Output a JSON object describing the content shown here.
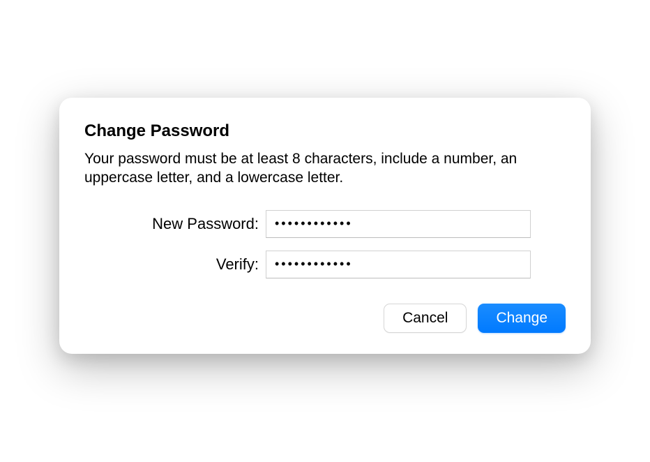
{
  "dialog": {
    "title": "Change Password",
    "description": "Your password must be at least 8 characters, include a number, an uppercase letter, and a lowercase letter.",
    "fields": {
      "new_password": {
        "label": "New Password:",
        "value": "●●●●●●●●●●●●"
      },
      "verify": {
        "label": "Verify:",
        "value": "●●●●●●●●●●●●"
      }
    },
    "buttons": {
      "cancel": "Cancel",
      "confirm": "Change"
    }
  }
}
